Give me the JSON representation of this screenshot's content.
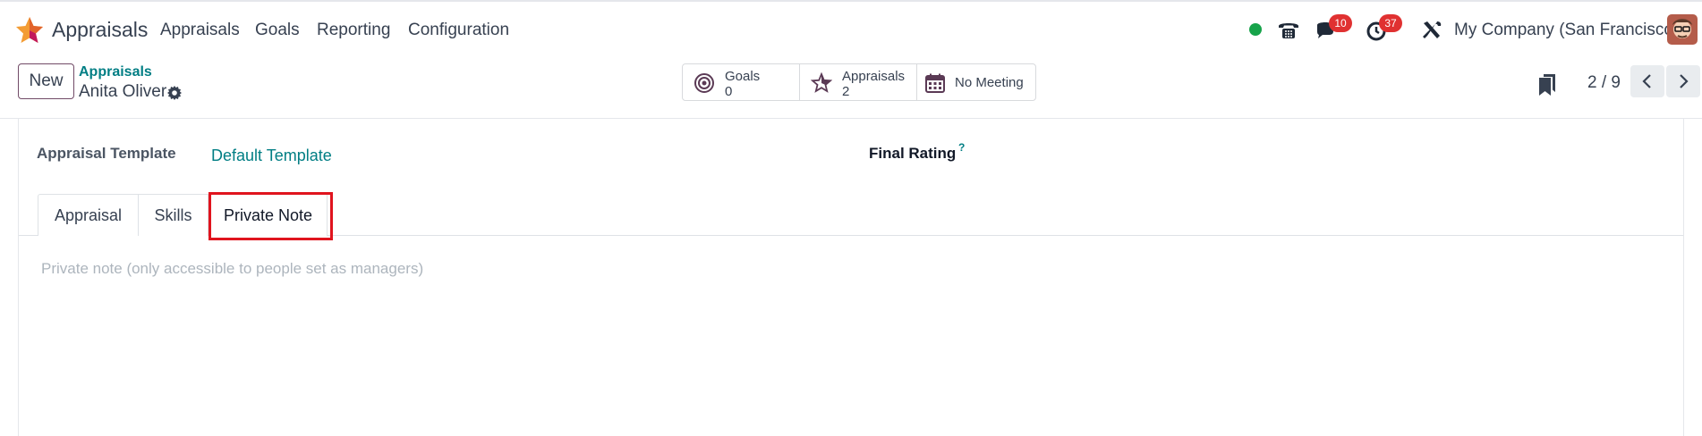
{
  "navbar": {
    "app_name": "Appraisals",
    "menu": [
      "Appraisals",
      "Goals",
      "Reporting",
      "Configuration"
    ],
    "status_color": "#16a34a",
    "messages_badge": "10",
    "activities_badge": "37",
    "company": "My Company (San Francisco)",
    "icons": [
      "appraisals-app-icon",
      "phone-icon",
      "chat-icon",
      "clock-icon",
      "tools-icon"
    ]
  },
  "control": {
    "new_label": "New",
    "breadcrumb_parent": "Appraisals",
    "record_name": "Anita Oliver",
    "smart_buttons": {
      "goals": {
        "label": "Goals",
        "value": "0"
      },
      "appraisals": {
        "label": "Appraisals",
        "value": "2"
      },
      "meeting": {
        "label": "No Meeting"
      }
    },
    "pager": "2 / 9"
  },
  "form": {
    "template_label": "Appraisal Template",
    "template_value": "Default Template",
    "final_rating_label": "Final Rating",
    "help_mark": "?",
    "tabs": [
      "Appraisal",
      "Skills",
      "Private Note"
    ],
    "active_tab": "Private Note",
    "private_note_placeholder": "Private note (only accessible to people set as managers)"
  },
  "colors": {
    "brand": "#714b67",
    "link": "#017e84",
    "badge": "#e03131",
    "highlight": "#e0141e"
  }
}
